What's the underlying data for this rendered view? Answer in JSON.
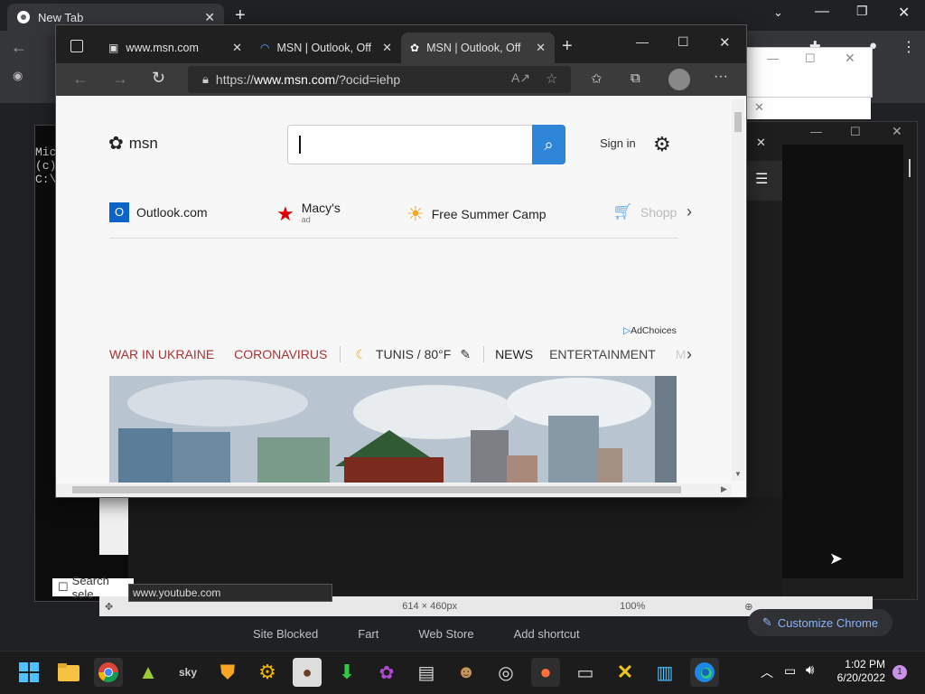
{
  "chrome": {
    "tab_title": "New Tab",
    "bottom_links": [
      "Site Blocked",
      "Fart",
      "Web Store",
      "Add shortcut"
    ],
    "customize_label": "Customize Chrome"
  },
  "terminal": {
    "lines": [
      "Mic",
      "(c)",
      "",
      "C:\\"
    ]
  },
  "search_select_label": "Search sele",
  "status_url": "www.youtube.com",
  "bottom_bar": {
    "dimensions": "614 × 460px",
    "zoom": "100%"
  },
  "edge": {
    "tabs": [
      {
        "label": "www.msn.com"
      },
      {
        "label": "MSN | Outlook, Off"
      },
      {
        "label": "MSN | Outlook, Off"
      }
    ],
    "address": {
      "prefix": "https://",
      "host": "www.msn.com",
      "path": "/?ocid=iehp"
    }
  },
  "msn": {
    "logo_text": "msn",
    "search_placeholder": "",
    "signin_label": "Sign in",
    "quick_links": [
      {
        "label": "Outlook.com",
        "sub": ""
      },
      {
        "label": "Macy's",
        "sub": "ad"
      },
      {
        "label": "Free Summer Camp",
        "sub": ""
      },
      {
        "label": "Shopp",
        "sub": ""
      }
    ],
    "adchoices": "AdChoices",
    "nav": {
      "war": "WAR IN UKRAINE",
      "corona": "CORONAVIRUS",
      "weather": "TUNIS / 80°F",
      "news": "NEWS",
      "entertainment": "ENTERTAINMENT",
      "more": "M"
    }
  },
  "taskbar": {
    "time": "1:02 PM",
    "date": "6/20/2022",
    "notification_count": "1"
  }
}
